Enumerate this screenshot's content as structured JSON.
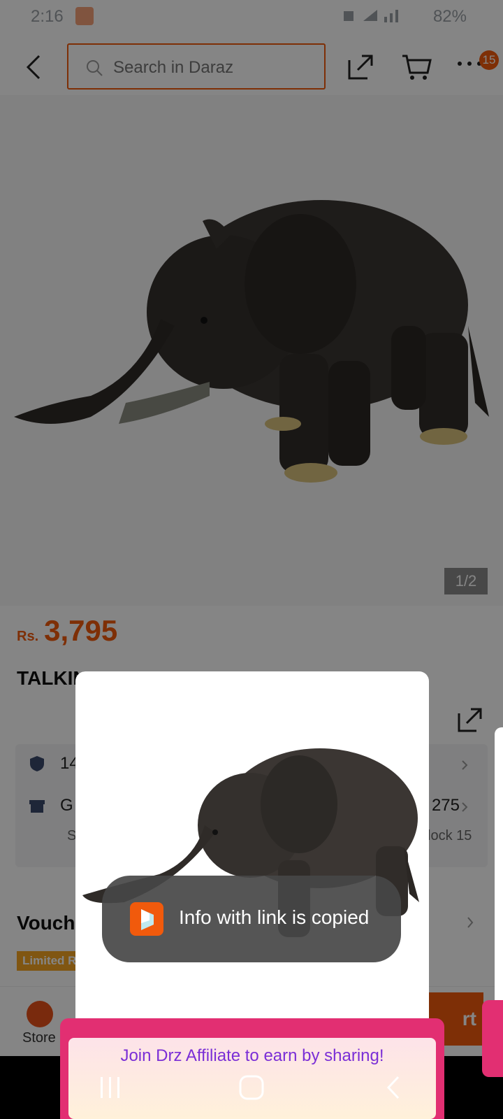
{
  "status_bar": {
    "time": "2:16",
    "battery": "82%"
  },
  "search": {
    "placeholder": "Search in Daraz"
  },
  "cart": {
    "badge": "15"
  },
  "gallery": {
    "counter": "1/2"
  },
  "price": {
    "currency": "Rs.",
    "value": "3,795"
  },
  "product": {
    "title_visible": "TALKIN"
  },
  "info": {
    "row1_text": "14",
    "row2_text": "G",
    "row2_amount": "275",
    "row2_sub_left": "S",
    "row2_sub_right": "lock 15"
  },
  "vouchers": {
    "heading_visible": "Vouch",
    "tag_visible": "Limited R"
  },
  "bottom": {
    "store_label": "Store",
    "cart_partial": "rt"
  },
  "toast": {
    "message": "Info with link is copied"
  },
  "affiliate": {
    "message": "Join Drz Affiliate to earn by sharing!"
  },
  "colors": {
    "brand": "#f15a0c",
    "affiliate_text": "#7b2fd6",
    "affiliate_bg": "#e22f72"
  },
  "icons": {
    "back": "back-arrow-icon",
    "search": "search-icon",
    "share": "share-icon",
    "cart": "cart-icon",
    "more": "more-icon",
    "nav_recent": "recent-apps-icon",
    "nav_home": "home-icon",
    "nav_back": "nav-back-icon"
  }
}
